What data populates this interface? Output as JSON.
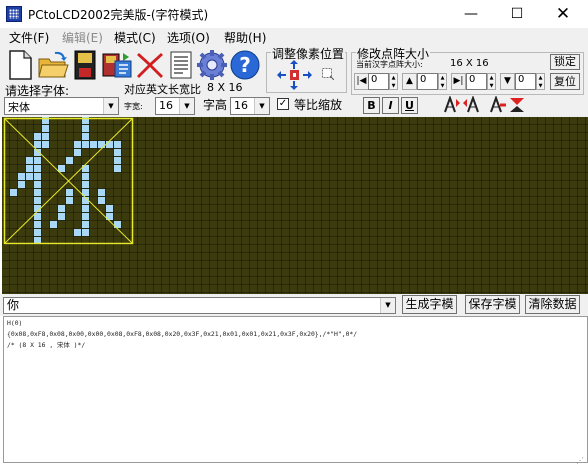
{
  "window": {
    "title": "PCtoLCD2002完美版-(字符模式)",
    "minimize_glyph": "—",
    "maximize_glyph": "☐",
    "close_glyph": "✕"
  },
  "menu": [
    {
      "label": "文件(F)",
      "enabled": true
    },
    {
      "label": "编辑(E)",
      "enabled": false
    },
    {
      "label": "模式(C)",
      "enabled": true
    },
    {
      "label": "选项(O)",
      "enabled": true
    },
    {
      "label": "帮助(H)",
      "enabled": true
    }
  ],
  "toolbar": {
    "icons": [
      "new-file-icon",
      "open-folder-icon",
      "save-icon",
      "save-as-icon",
      "delete-icon",
      "notes-icon",
      "settings-icon",
      "help-icon"
    ]
  },
  "adjust_pixel": {
    "title": "调整像素位置",
    "icons": [
      "shift-up-icon",
      "shift-left-icon",
      "shift-center-icon",
      "shift-right-icon",
      "shift-down-icon",
      "bring-region-icon"
    ]
  },
  "dot_matrix": {
    "title": "修改点阵大小",
    "current_label": "当前汉字点阵大小:",
    "current_size": "16 X 16",
    "lock_label": "锁定",
    "restore_label": "复位",
    "spinners": [
      "0",
      "0",
      "0",
      "0"
    ]
  },
  "font": {
    "select_label": "请选择字体:",
    "selected_font": "宋体",
    "english_width_label": "对应英文长宽比",
    "english_width_value": "8 X 16",
    "width_label": "字宽:",
    "width_value": "16",
    "height_label": "字高",
    "height_value": "16",
    "scale_label": "等比缩放",
    "scale_checked": true
  },
  "format_buttons": {
    "bold": "B",
    "italic": "I",
    "underline": "U"
  },
  "text_input": {
    "value": "你"
  },
  "actions": {
    "generate": "生成字模",
    "save": "保存字模",
    "clear": "清除数据"
  },
  "output": {
    "lines": [
      "H(0)",
      "",
      "{0x08,0xF8,0x08,0x00,0x00,0x08,0xF8,0x08,0x20,0x3F,0x21,0x01,0x01,0x21,0x3F,0x20},/*\"H\",0*/",
      "/* (8 X 16 , 宋体 )*/"
    ]
  },
  "glyph": {
    "cols": 16,
    "rows": 16,
    "on_pixels": [
      [
        5,
        0
      ],
      [
        10,
        0
      ],
      [
        5,
        1
      ],
      [
        10,
        1
      ],
      [
        4,
        2
      ],
      [
        5,
        2
      ],
      [
        10,
        2
      ],
      [
        4,
        3
      ],
      [
        5,
        3
      ],
      [
        9,
        3
      ],
      [
        10,
        3
      ],
      [
        11,
        3
      ],
      [
        12,
        3
      ],
      [
        13,
        3
      ],
      [
        14,
        3
      ],
      [
        4,
        4
      ],
      [
        9,
        4
      ],
      [
        14,
        4
      ],
      [
        3,
        5
      ],
      [
        4,
        5
      ],
      [
        8,
        5
      ],
      [
        14,
        5
      ],
      [
        3,
        6
      ],
      [
        4,
        6
      ],
      [
        7,
        6
      ],
      [
        10,
        6
      ],
      [
        14,
        6
      ],
      [
        2,
        7
      ],
      [
        3,
        7
      ],
      [
        4,
        7
      ],
      [
        10,
        7
      ],
      [
        2,
        8
      ],
      [
        4,
        8
      ],
      [
        10,
        8
      ],
      [
        1,
        9
      ],
      [
        4,
        9
      ],
      [
        8,
        9
      ],
      [
        10,
        9
      ],
      [
        12,
        9
      ],
      [
        4,
        10
      ],
      [
        8,
        10
      ],
      [
        10,
        10
      ],
      [
        12,
        10
      ],
      [
        4,
        11
      ],
      [
        7,
        11
      ],
      [
        10,
        11
      ],
      [
        13,
        11
      ],
      [
        4,
        12
      ],
      [
        7,
        12
      ],
      [
        10,
        12
      ],
      [
        13,
        12
      ],
      [
        4,
        13
      ],
      [
        6,
        13
      ],
      [
        10,
        13
      ],
      [
        14,
        13
      ],
      [
        4,
        14
      ],
      [
        9,
        14
      ],
      [
        10,
        14
      ],
      [
        4,
        15
      ]
    ]
  },
  "colors": {
    "canvas_bg": "#3b3b0e",
    "grid_line": "#15150a",
    "pixel_on": "#a9d8f7",
    "selection": "#e8e82a",
    "chrome": "#f0f0f0"
  }
}
